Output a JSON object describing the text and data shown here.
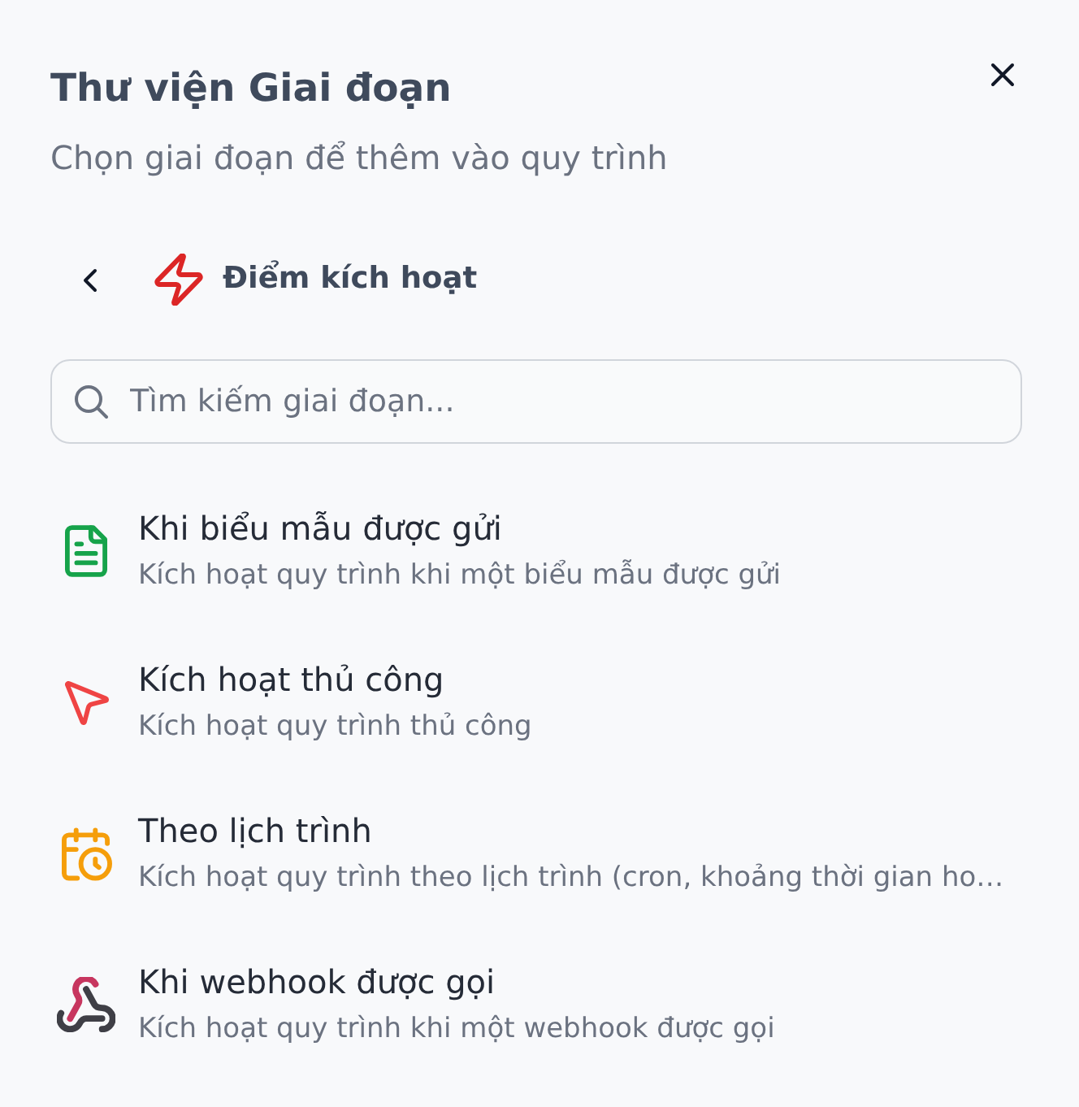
{
  "dialog": {
    "title": "Thư viện Giai đoạn",
    "subtitle": "Chọn giai đoạn để thêm vào quy trình"
  },
  "category": {
    "title": "Điểm kích hoạt"
  },
  "search": {
    "placeholder": "Tìm kiếm giai đoạn..."
  },
  "stages": [
    {
      "kind": "form",
      "title": "Khi biểu mẫu được gửi",
      "description": "Kích hoạt quy trình khi một biểu mẫu được gửi"
    },
    {
      "kind": "manual",
      "title": "Kích hoạt thủ công",
      "description": "Kích hoạt quy trình thủ công"
    },
    {
      "kind": "schedule",
      "title": "Theo lịch trình",
      "description": "Kích hoạt quy trình theo lịch trình (cron, khoảng thời gian ho…"
    },
    {
      "kind": "webhook",
      "title": "Khi webhook được gọi",
      "description": "Kích hoạt quy trình khi một webhook được gọi"
    }
  ]
}
